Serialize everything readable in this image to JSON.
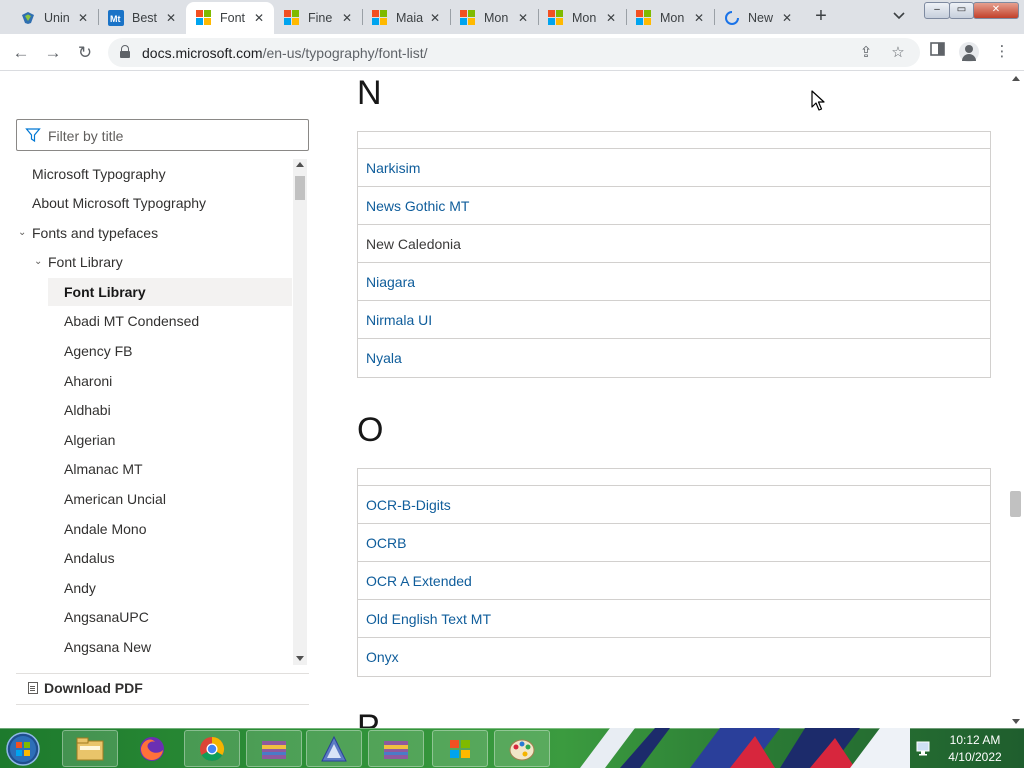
{
  "browser": {
    "tabs": [
      {
        "label": "Unin",
        "icon": "shield-icon",
        "active": false
      },
      {
        "label": "Best",
        "icon": "mt-icon",
        "active": false
      },
      {
        "label": "Font",
        "icon": "microsoft-icon",
        "active": true
      },
      {
        "label": "Fine",
        "icon": "microsoft-icon",
        "active": false
      },
      {
        "label": "Maia",
        "icon": "microsoft-icon",
        "active": false
      },
      {
        "label": "Mon",
        "icon": "microsoft-icon",
        "active": false
      },
      {
        "label": "Mon",
        "icon": "microsoft-icon",
        "active": false
      },
      {
        "label": "Mon",
        "icon": "microsoft-icon",
        "active": false
      },
      {
        "label": "New",
        "icon": "loading-icon",
        "active": false
      }
    ],
    "tab_close_glyph": "✕",
    "new_tab_glyph": "+",
    "tab_search_glyph": "⌄",
    "window_controls": {
      "minimize": "–",
      "maximize": "▭",
      "close": "✕"
    },
    "url_host": "docs.microsoft.com",
    "url_path": "/en-us/typography/font-list/",
    "nav": {
      "back": "←",
      "forward": "→",
      "reload": "↻"
    },
    "share_glyph": "⇪",
    "bookmark_glyph": "☆",
    "menu_glyph": "⋮"
  },
  "sidebar": {
    "filter_placeholder": "Filter by title",
    "items": [
      {
        "label": "Microsoft Typography",
        "level": 0,
        "expander": ""
      },
      {
        "label": "About Microsoft Typography",
        "level": 0,
        "expander": ""
      },
      {
        "label": "Fonts and typefaces",
        "level": 0,
        "expander": "⌄"
      },
      {
        "label": "Font Library",
        "level": 1,
        "expander": "⌄"
      },
      {
        "label": "Font Library",
        "level": 2,
        "expander": "",
        "selected": true
      },
      {
        "label": "Abadi MT Condensed",
        "level": 2,
        "expander": ""
      },
      {
        "label": "Agency FB",
        "level": 2,
        "expander": ""
      },
      {
        "label": "Aharoni",
        "level": 2,
        "expander": ""
      },
      {
        "label": "Aldhabi",
        "level": 2,
        "expander": ""
      },
      {
        "label": "Algerian",
        "level": 2,
        "expander": ""
      },
      {
        "label": "Almanac MT",
        "level": 2,
        "expander": ""
      },
      {
        "label": "American Uncial",
        "level": 2,
        "expander": ""
      },
      {
        "label": "Andale Mono",
        "level": 2,
        "expander": ""
      },
      {
        "label": "Andalus",
        "level": 2,
        "expander": ""
      },
      {
        "label": "Andy",
        "level": 2,
        "expander": ""
      },
      {
        "label": "AngsanaUPC",
        "level": 2,
        "expander": ""
      },
      {
        "label": "Angsana New",
        "level": 2,
        "expander": ""
      }
    ],
    "download_pdf": "Download PDF"
  },
  "content": {
    "sections": [
      {
        "letter": "N",
        "fonts": [
          {
            "name": "Narkisim",
            "link": true
          },
          {
            "name": "News Gothic MT",
            "link": true
          },
          {
            "name": "New Caledonia",
            "link": false
          },
          {
            "name": "Niagara",
            "link": true
          },
          {
            "name": "Nirmala UI",
            "link": true
          },
          {
            "name": "Nyala",
            "link": true
          }
        ]
      },
      {
        "letter": "O",
        "fonts": [
          {
            "name": "OCR-B-Digits",
            "link": true
          },
          {
            "name": "OCRB",
            "link": true
          },
          {
            "name": "OCR A Extended",
            "link": true
          },
          {
            "name": "Old English Text MT",
            "link": true
          },
          {
            "name": "Onyx",
            "link": true
          }
        ]
      },
      {
        "letter": "P",
        "fonts": []
      }
    ]
  },
  "taskbar": {
    "apps": [
      "windows-explorer-icon",
      "firefox-icon",
      "chrome-icon",
      "archive-icon",
      "tool-icon",
      "archive-icon",
      "windows-flag-icon",
      "paint-icon"
    ],
    "time": "10:12 AM",
    "date": "4/10/2022"
  },
  "colors": {
    "link": "#0f5d9b",
    "accent": "#0078d4",
    "selected_bg": "#f3f2f1"
  }
}
